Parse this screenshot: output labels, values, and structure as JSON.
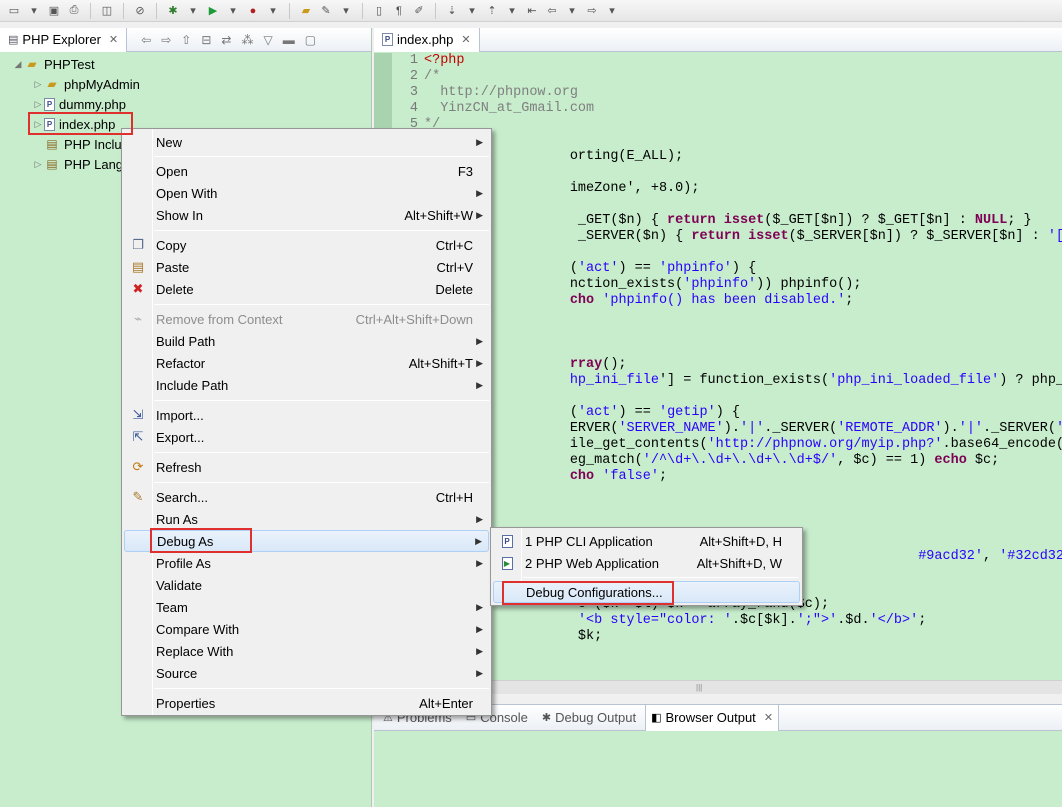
{
  "colors": {
    "accent_red": "#e0302e",
    "panel_green": "#c7edcc",
    "highlight_blue": "#d9e8f8"
  },
  "explorer": {
    "tab_label": "PHP Explorer",
    "tree": [
      {
        "label": "PHPTest",
        "icon": "project-folder-icon",
        "level": 0,
        "expanded": true
      },
      {
        "label": "phpMyAdmin",
        "icon": "folder-icon",
        "level": 1
      },
      {
        "label": "dummy.php",
        "icon": "php-file-icon",
        "level": 1
      },
      {
        "label": "index.php",
        "icon": "php-file-icon",
        "level": 1,
        "selected": true
      },
      {
        "label": "PHP Inclu",
        "icon": "library-icon",
        "level": 1
      },
      {
        "label": "PHP Lang",
        "icon": "library-icon",
        "level": 1
      }
    ]
  },
  "editor": {
    "tab_label": "index.php",
    "line_numbers": [
      "1",
      "2",
      "3",
      "4",
      "5"
    ]
  },
  "bottom_panel": {
    "tabs": [
      {
        "label": "Problems",
        "active": false
      },
      {
        "label": "Console",
        "active": false
      },
      {
        "label": "Debug Output",
        "active": false
      },
      {
        "label": "Browser Output",
        "active": true
      }
    ]
  },
  "context_menu": {
    "items": {
      "new": {
        "label": "New",
        "submenu": true
      },
      "open": {
        "label": "Open",
        "shortcut": "F3"
      },
      "open_with": {
        "label": "Open With",
        "submenu": true
      },
      "show_in": {
        "label": "Show In",
        "shortcut": "Alt+Shift+W",
        "submenu": true
      },
      "copy": {
        "label": "Copy",
        "shortcut": "Ctrl+C"
      },
      "paste": {
        "label": "Paste",
        "shortcut": "Ctrl+V"
      },
      "delete": {
        "label": "Delete",
        "shortcut": "Delete"
      },
      "remove_from_context": {
        "label": "Remove from Context",
        "shortcut": "Ctrl+Alt+Shift+Down",
        "disabled": true
      },
      "build_path": {
        "label": "Build Path",
        "submenu": true
      },
      "refactor": {
        "label": "Refactor",
        "shortcut": "Alt+Shift+T",
        "submenu": true
      },
      "include_path": {
        "label": "Include Path",
        "submenu": true
      },
      "import": {
        "label": "Import..."
      },
      "export": {
        "label": "Export..."
      },
      "refresh": {
        "label": "Refresh"
      },
      "search": {
        "label": "Search...",
        "shortcut": "Ctrl+H"
      },
      "run_as": {
        "label": "Run As",
        "submenu": true
      },
      "debug_as": {
        "label": "Debug As",
        "submenu": true,
        "highlighted": true
      },
      "profile_as": {
        "label": "Profile As",
        "submenu": true
      },
      "validate": {
        "label": "Validate"
      },
      "team": {
        "label": "Team",
        "submenu": true
      },
      "compare_with": {
        "label": "Compare With",
        "submenu": true
      },
      "replace_with": {
        "label": "Replace With",
        "submenu": true
      },
      "source": {
        "label": "Source",
        "submenu": true
      },
      "properties": {
        "label": "Properties",
        "shortcut": "Alt+Enter"
      }
    }
  },
  "debug_submenu": {
    "items": {
      "php_cli": {
        "label": "1 PHP CLI Application",
        "shortcut": "Alt+Shift+D, H"
      },
      "php_web": {
        "label": "2 PHP Web Application",
        "shortcut": "Alt+Shift+D, W"
      },
      "debug_configurations": {
        "label": "Debug Configurations..."
      }
    }
  }
}
